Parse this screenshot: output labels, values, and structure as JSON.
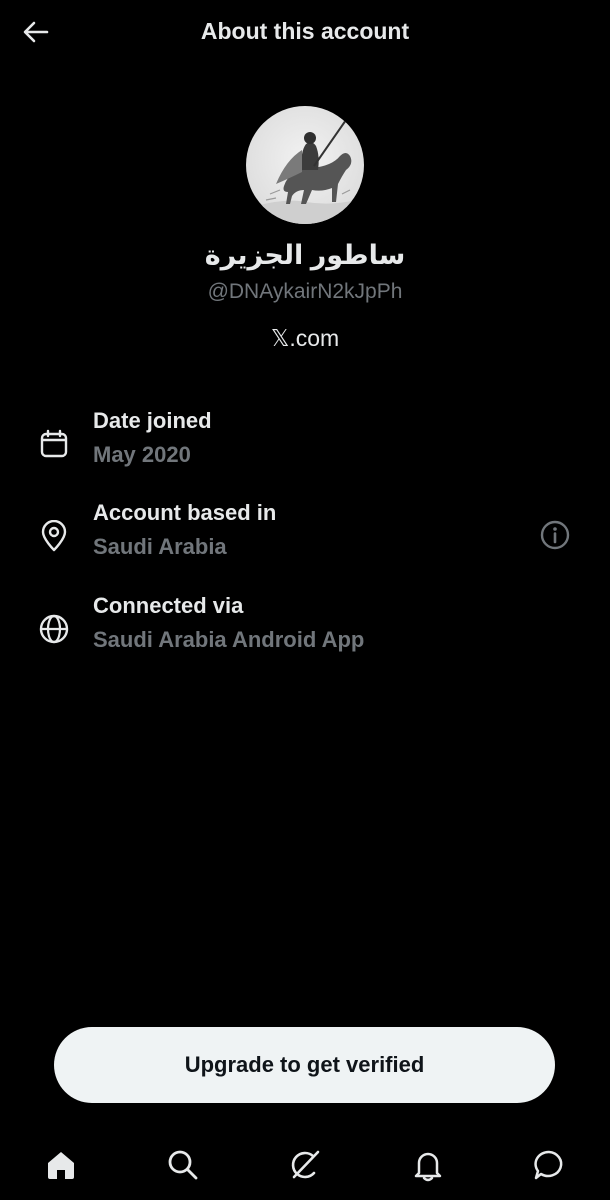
{
  "header": {
    "title": "About this account",
    "back_icon": "arrow-left-icon"
  },
  "profile": {
    "display_name": "ساطور الجزيرة",
    "handle": "@DNAykairN2kJpPh",
    "platform": "𝕏.com"
  },
  "details": [
    {
      "icon": "calendar-icon",
      "label": "Date joined",
      "value": "May 2020"
    },
    {
      "icon": "location-pin-icon",
      "label": "Account based in",
      "value": "Saudi Arabia",
      "action_icon": "info-icon"
    },
    {
      "icon": "globe-icon",
      "label": "Connected via",
      "value": "Saudi Arabia Android App"
    }
  ],
  "upgrade": {
    "label": "Upgrade to get verified"
  },
  "nav": {
    "items": [
      "home-icon",
      "search-icon",
      "grok-icon",
      "notifications-bell-icon",
      "messages-icon"
    ]
  },
  "colors": {
    "background": "#000000",
    "primary_text": "#e7e9ea",
    "secondary_text": "#71767b",
    "button_bg": "#eff3f4",
    "button_text": "#0f1419"
  }
}
